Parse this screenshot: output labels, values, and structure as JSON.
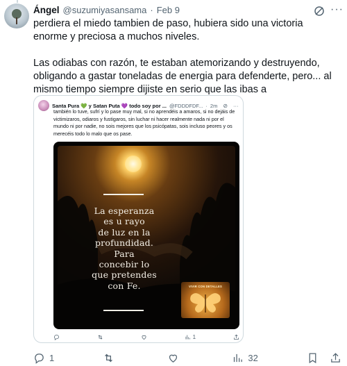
{
  "post": {
    "display_name": "Ángel",
    "handle": "@suzumiyasansama",
    "separator": "·",
    "date": "Feb 9",
    "paragraph_1": "perdiera el miedo tambien de paso, hubiera sido una victoria enorme y preciosa a muchos niveles.",
    "paragraph_2": "Las odiabas con razón, te estaban atemorizando y destruyendo, obligando a gastar toneladas de energia para defenderte, pero... al mismo tiempo siempre dijiste en serio que las ibas a",
    "icons": [
      "grok-icon",
      "more-icon"
    ]
  },
  "quoted": {
    "display_name": "Santa Pura 💚 y Satan Puta 💜 todo soy por ...",
    "handle": "@FDDDFDF...",
    "separator": "·",
    "time": "2m",
    "text": "también lo tuve, sufrí y lo pase muy mal, si no aprendéis a amaros, si no dejáis de victimizaros, odiaros y fustigaros, sin luchar ni hacer realmente nada ni por el mundo ni por nadie, no sois mejores que los psicópatas, sois incluso peores y os merecéis todo lo malo que os pase.",
    "image_text": [
      "La esperanza",
      "es u rayo",
      "de luz en la",
      "profundidad.",
      "Para",
      "concebir lo",
      "que pretendes",
      "con Fe."
    ],
    "card_label": "VIVIR CON DETALLES",
    "actions": {
      "reply": "",
      "repost": "",
      "like": "",
      "views": "1"
    }
  },
  "actions": {
    "reply_count": "1",
    "repost_count": "",
    "like_count": "",
    "views_count": "32"
  },
  "colors": {
    "text": "#0f1419",
    "secondary": "#536471",
    "border": "#cfd9de"
  }
}
